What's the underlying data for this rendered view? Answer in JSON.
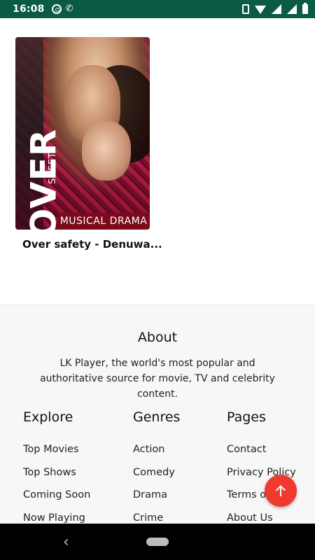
{
  "status_bar": {
    "time": "16:08",
    "left_icons": [
      "at-circle-icon",
      "phone-call-icon"
    ],
    "right_icons": [
      "vibrate-icon",
      "wifi-icon",
      "signal-x-icon",
      "signal-icon",
      "battery-icon"
    ],
    "background": "#0a5a45"
  },
  "movie": {
    "title": "Over safety - Denuwa...",
    "poster": {
      "title_text": "OVER",
      "subtitle_text": "SAFETY",
      "genre_text": "MUSICAL DRAMA"
    }
  },
  "footer": {
    "about_title": "About",
    "about_text": "LK Player, the world's most popular and authoritative source for movie, TV and celebrity content.",
    "columns": [
      {
        "heading": "Explore",
        "items": [
          "Top Movies",
          "Top Shows",
          "Coming Soon",
          "Now Playing"
        ]
      },
      {
        "heading": "Genres",
        "items": [
          "Action",
          "Comedy",
          "Drama",
          "Crime"
        ]
      },
      {
        "heading": "Pages",
        "items": [
          "Contact",
          "Privacy Policy",
          "Terms of Use",
          "About Us"
        ]
      }
    ]
  },
  "fab": {
    "icon": "arrow-up-icon",
    "color": "#f03a30"
  },
  "nav_bar": {
    "back_icon": "back-chevron-icon",
    "home_icon": "home-pill-icon"
  }
}
